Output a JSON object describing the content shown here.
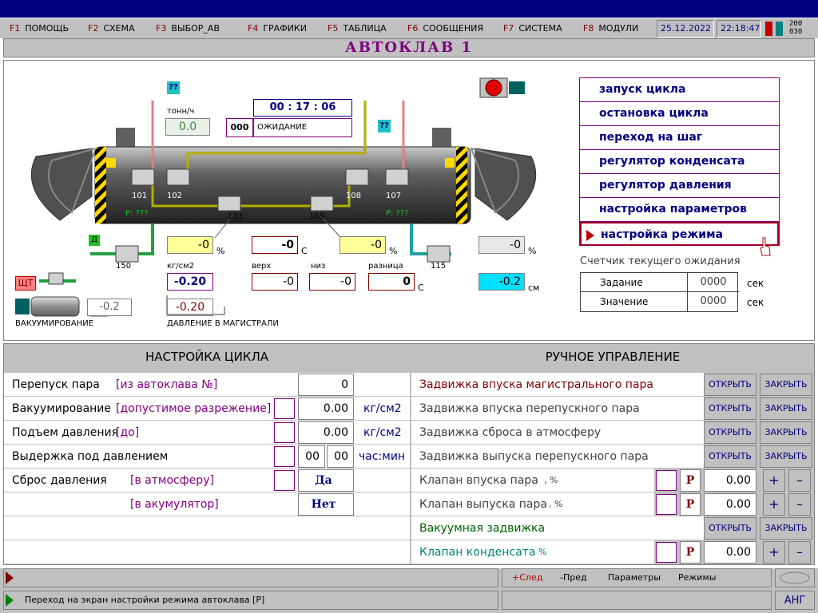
{
  "menu": {
    "items": [
      {
        "key": "F1",
        "label": "ПОМОЩЬ"
      },
      {
        "key": "F2",
        "label": "СХЕМА"
      },
      {
        "key": "F3",
        "label": "ВЫБОР_АВ"
      },
      {
        "key": "F4",
        "label": "ГРАФИКИ"
      },
      {
        "key": "F5",
        "label": "ТАБЛИЦА"
      },
      {
        "key": "F6",
        "label": "СООБЩЕНИЯ"
      },
      {
        "key": "F7",
        "label": "СИСТЕМА"
      },
      {
        "key": "F8",
        "label": "МОДУЛИ"
      }
    ],
    "date": "25.12.2022",
    "time": "22:18:47",
    "corner_code_top": "200",
    "corner_code_bottom": "030"
  },
  "title": "АВТОКЛАВ 1",
  "scheme": {
    "unknown_top": "??",
    "unknown_right": "??",
    "flow_unit": "тонн/ч",
    "flow_value": "0.0",
    "timer": "00 : 17 : 06",
    "state_code": "000",
    "state_text": "ОЖИДАНИЕ",
    "valves": {
      "v101": "101",
      "v102": "102",
      "v103": "103",
      "v109": "109",
      "v108": "108",
      "v107": "107",
      "v150": "150",
      "v115": "115"
    },
    "p_left": "P: ???",
    "p_right": "P: ???",
    "left_valve_pct": "-0",
    "temp_value": "-0",
    "right_valve_pct": "-0",
    "right_far_pct": "-0",
    "pct_unit": "%",
    "c_unit": "С",
    "pressure_label": "кг/см2",
    "pressure_value": "-0.20",
    "top_label": "верх",
    "top_value": "-0",
    "bottom_label": "низ",
    "bottom_value": "-0",
    "diff_label": "разница",
    "diff_value": "0",
    "level_value": "-0.2",
    "level_unit": "см",
    "shield_label": "ЩТ",
    "green_marker": "Д",
    "vacuum_value": "-0.2",
    "vacuum_label": "ВАКУУМИРОВАНИЕ",
    "main_pressure_value": "-0.20",
    "main_pressure_label": "ДАВЛЕНИЕ В МАГИСТРАЛИ"
  },
  "commands": [
    {
      "label": "запуск цикла"
    },
    {
      "label": "остановка цикла"
    },
    {
      "label": "переход на шаг"
    },
    {
      "label": "регулятор конденсата"
    },
    {
      "label": "регулятор давления"
    },
    {
      "label": "настройка параметров"
    },
    {
      "label": "настройка режима"
    }
  ],
  "counter": {
    "title": "Счетчик текущего ожидания",
    "task_label": "Задание",
    "task_value": "0000",
    "value_label": "Значение",
    "value_value": "0000",
    "unit": "сек"
  },
  "cycle": {
    "header": "НАСТРОЙКА ЦИКЛА",
    "rows": [
      {
        "label": "Перепуск пара",
        "hint": "[из автоклава №]",
        "value": "0",
        "unit": ""
      },
      {
        "label": "Вакуумирование",
        "hint": "[допустимое разрежение]",
        "value": "0.00",
        "unit": "кг/см2"
      },
      {
        "label": "Подъем давления",
        "hint": "[до]",
        "value": "0.00",
        "unit": "кг/см2"
      },
      {
        "label": "Выдержка под давлением",
        "hint": "",
        "value_h": "00",
        "value_m": "00",
        "unit": "час:мин"
      },
      {
        "label": "Сброс давления",
        "hint": "[в атмосферу]",
        "value": "Да",
        "unit": ""
      },
      {
        "label": "",
        "hint": "[в акумулятор]",
        "value": "Нет",
        "unit": ""
      }
    ]
  },
  "manual": {
    "header": "РУЧНОЕ УПРАВЛЕНИЕ",
    "open_label": "ОТКРЫТЬ",
    "close_label": "ЗАКРЫТЬ",
    "p_label": "Р",
    "plus": "+",
    "minus": "–",
    "rows": [
      {
        "label": "Задвижка впуска магистрального пара"
      },
      {
        "label": "Задвижка впуска перепускного пара"
      },
      {
        "label": "Задвижка сброса в атмосферу"
      },
      {
        "label": "Задвижка выпуска перепускного пара"
      },
      {
        "label": "Клапан впуска пара",
        "suffix": ", %",
        "value": "0.00"
      },
      {
        "label": "Клапан выпуска пара",
        "suffix": ", %",
        "value": "0.00"
      },
      {
        "label": "Вакуумная задвижка"
      },
      {
        "label": "Клапан конденсата",
        "suffix": ", %",
        "value": "0.00"
      }
    ]
  },
  "status": {
    "nav_next": "+След",
    "nav_prev": "-Пред",
    "nav_params": "Параметры",
    "nav_modes": "Режимы",
    "message": "Переход на экран настройки режима автоклава [Р]",
    "lang": "АНГ"
  }
}
